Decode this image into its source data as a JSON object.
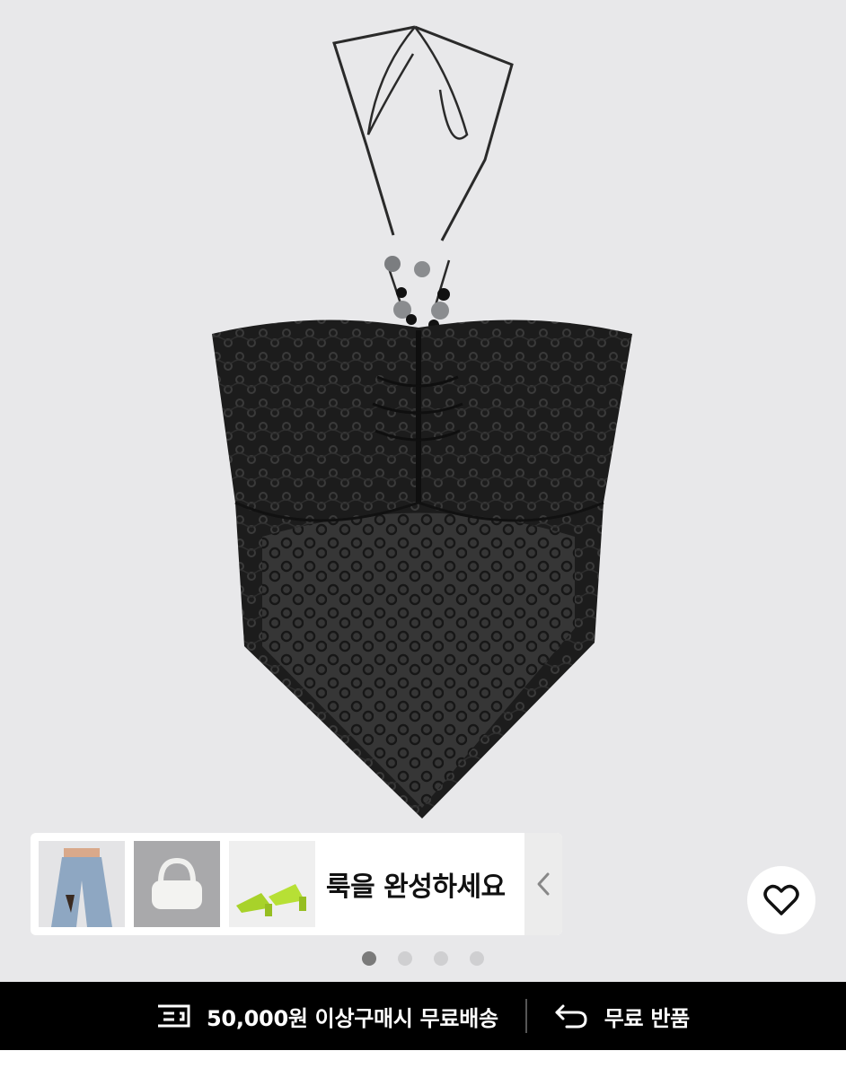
{
  "product": {
    "image_icon": "product-photo-halter-top",
    "background_color": "#e8e8ea"
  },
  "look": {
    "title": "룩을 완성하세요",
    "items": [
      {
        "icon": "jeans-thumbnail"
      },
      {
        "icon": "bag-thumbnail"
      },
      {
        "icon": "sandals-thumbnail"
      }
    ],
    "toggle_icon": "chevron-left-icon"
  },
  "favorite": {
    "icon": "heart-icon"
  },
  "carousel": {
    "total": 4,
    "active": 1
  },
  "benefits": {
    "shipping": {
      "icon": "delivery-truck-icon",
      "label": "50,000원 이상구매시 무료배송"
    },
    "returns": {
      "icon": "return-arrow-icon",
      "label": "무료 반품"
    }
  }
}
